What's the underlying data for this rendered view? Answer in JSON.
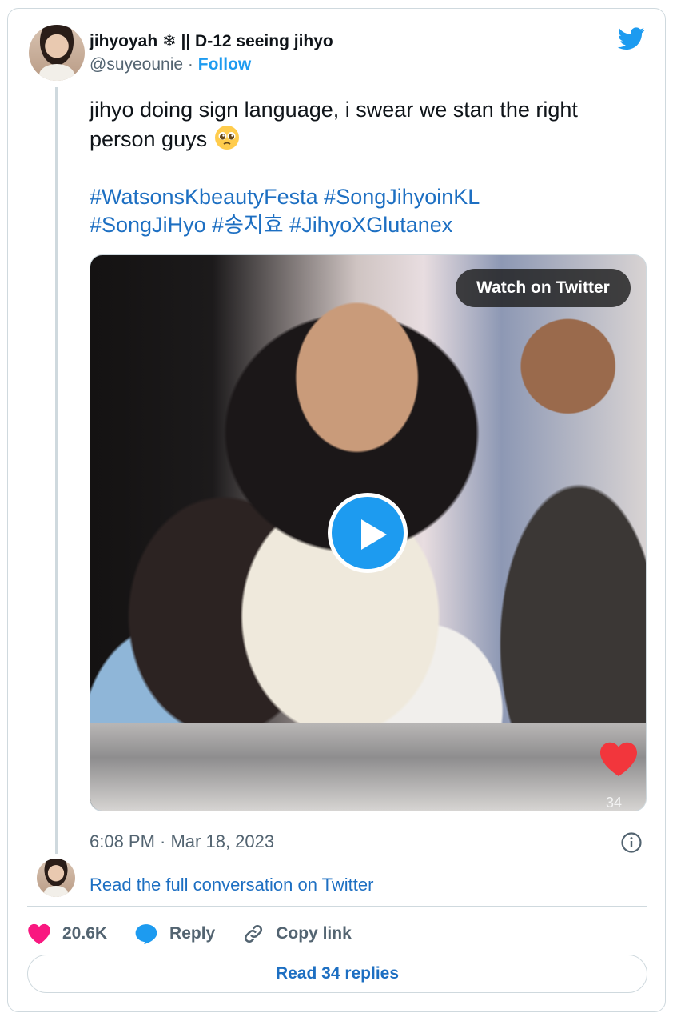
{
  "author": {
    "display_name": "jihyoyah ❄ || D-12 seeing jihyo",
    "handle": "@suyeounie",
    "separator": "·",
    "follow_label": "Follow"
  },
  "tweet": {
    "text": "jihyo doing sign language, i swear we stan the right person guys",
    "emoji": "pleading-face",
    "hashtags": [
      "#WatsonsKbeautyFesta",
      "#SongJihyoinKL",
      "#SongJiHyo",
      "#송지효",
      "#JihyoXGlutanex"
    ]
  },
  "media": {
    "watch_label": "Watch on Twitter",
    "overlay_count": "34"
  },
  "timestamp": "6:08 PM · Mar 18, 2023",
  "conversation_link": "Read the full conversation on Twitter",
  "actions": {
    "likes": "20.6K",
    "reply_label": "Reply",
    "copy_label": "Copy link"
  },
  "read_replies_label": "Read 34 replies",
  "colors": {
    "link": "#1d6fc2",
    "brand": "#1d9bf0",
    "like": "#f91880",
    "muted": "#536471",
    "border": "#cfd9de"
  },
  "icons": {
    "brand": "twitter-bird-icon",
    "play": "play-icon",
    "info": "info-icon",
    "like": "heart-icon",
    "reply": "reply-bubble-icon",
    "copy": "link-icon"
  }
}
